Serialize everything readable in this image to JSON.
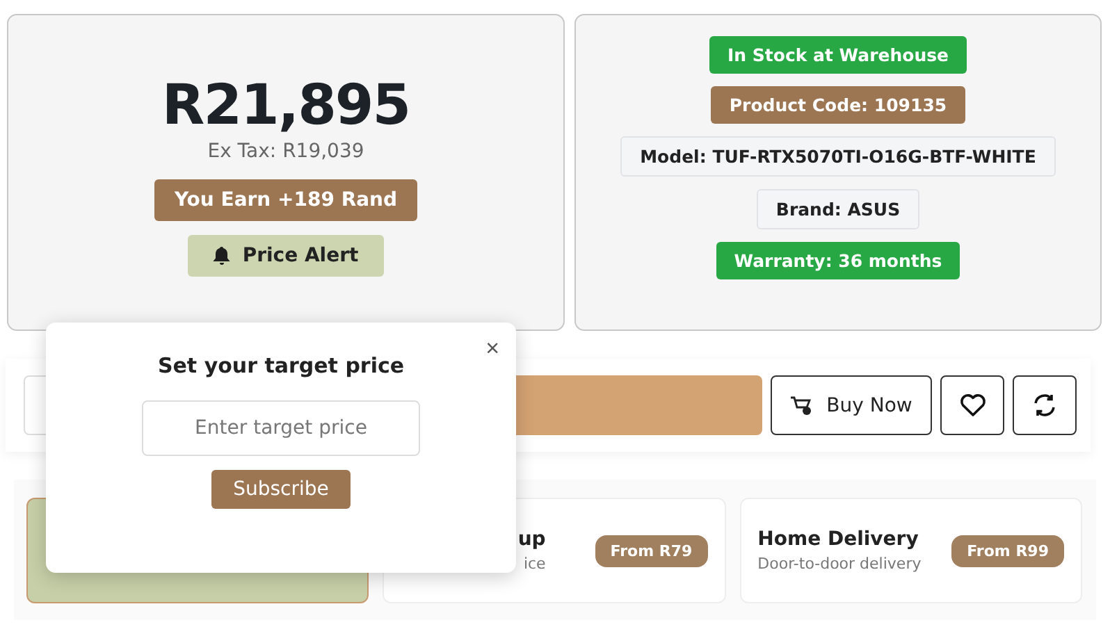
{
  "price": {
    "amount": "R21,895",
    "ex_tax": "Ex Tax: R19,039",
    "earn_badge": "You Earn +189 Rand",
    "alert_button": "Price Alert"
  },
  "details": [
    {
      "text": "In Stock at Warehouse",
      "kind": "success"
    },
    {
      "text": "Product Code: 109135",
      "kind": "brand"
    },
    {
      "text": "Model: TUF-RTX5070TI-O16G-BTF-WHITE",
      "kind": "plain"
    },
    {
      "text": "Brand: ASUS",
      "kind": "plain"
    },
    {
      "text": "Warranty: 36 months",
      "kind": "success"
    }
  ],
  "actions": {
    "buy_now": "Buy Now"
  },
  "delivery": [
    {
      "selected": true
    },
    {
      "title": "up",
      "subtitle": "ice",
      "price": "From R79",
      "selected": false
    },
    {
      "title": "Home Delivery",
      "subtitle": "Door-to-door delivery",
      "price": "From R99",
      "selected": false
    }
  ],
  "popup": {
    "title": "Set your target price",
    "close": "×",
    "placeholder": "Enter target price",
    "button": "Subscribe"
  }
}
